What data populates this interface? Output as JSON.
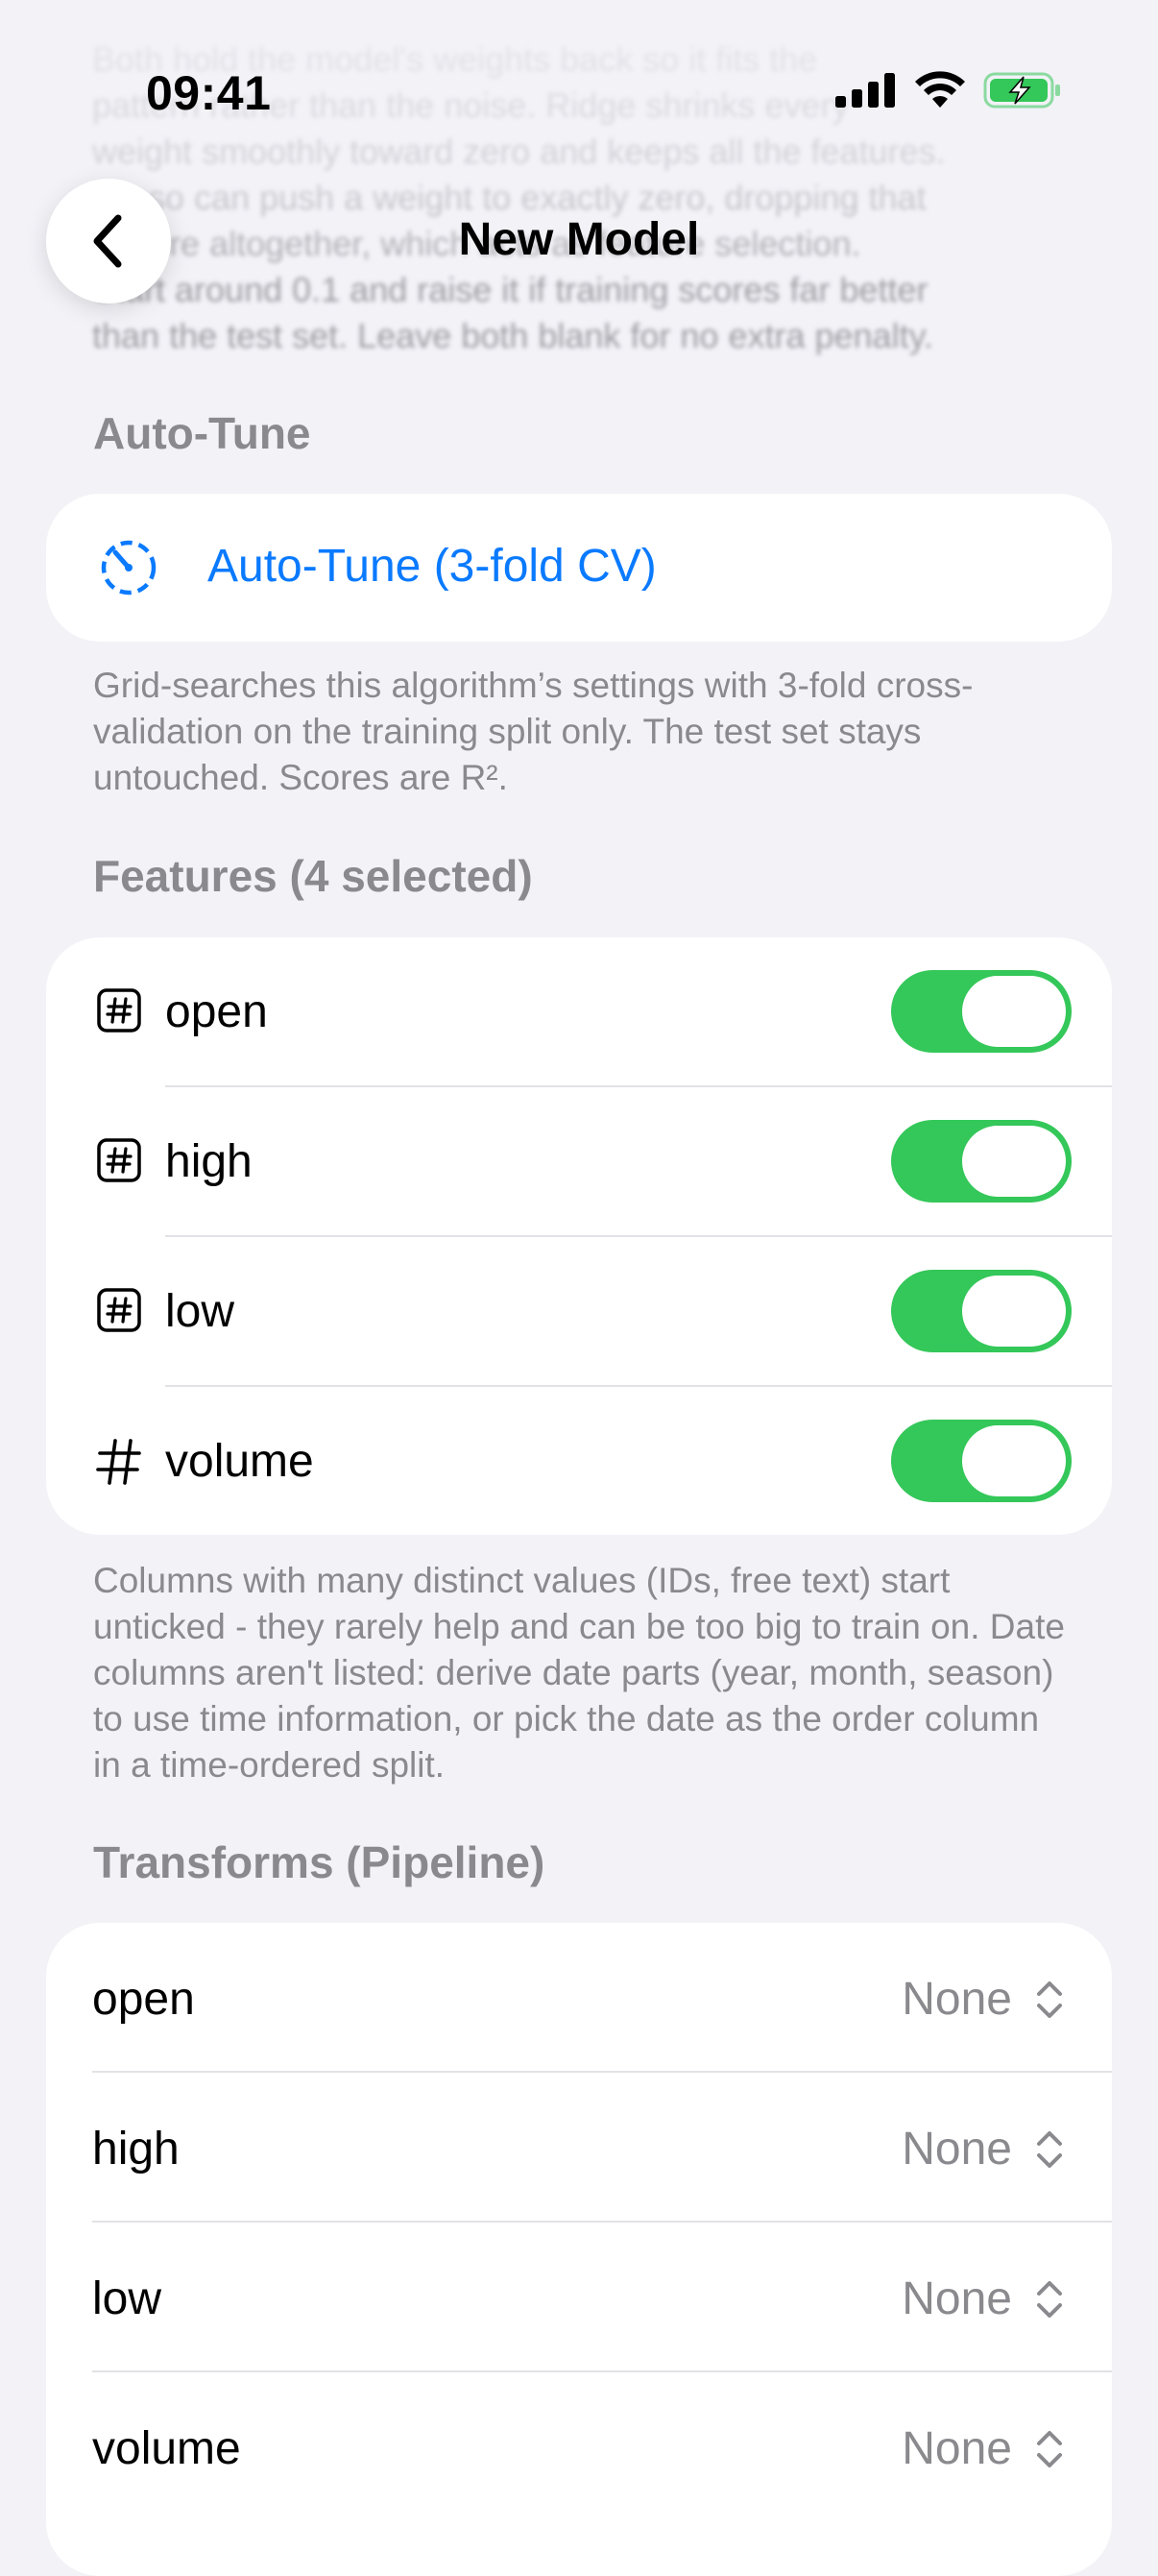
{
  "status_bar": {
    "time": "09:41"
  },
  "nav": {
    "title": "New Model",
    "back_icon": "chevron-left-icon"
  },
  "regularization_note": {
    "lines": [
      "Both hold the model's weights back so it fits the",
      "pattern rather than the noise. Ridge shrinks every",
      "weight smoothly toward zero and keeps all the features.",
      "Lasso can push a weight to exactly zero, dropping that",
      "feature altogether, which acts as feature selection.",
      "Start around 0.1 and raise it if training scores far better",
      "than the test set. Leave both blank for no extra penalty."
    ]
  },
  "autotune": {
    "header": "Auto-Tune",
    "button_label": "Auto-Tune (3-fold CV)",
    "footnote": "Grid-searches this algorithm’s settings with 3-fold cross-validation on the training split only. The test set stays untouched. Scores are R².",
    "accent_color": "#0A7AFF"
  },
  "features": {
    "header": "Features (4 selected)",
    "items": [
      {
        "label": "open",
        "icon": "number-square-icon",
        "enabled": true
      },
      {
        "label": "high",
        "icon": "number-square-icon",
        "enabled": true
      },
      {
        "label": "low",
        "icon": "number-square-icon",
        "enabled": true
      },
      {
        "label": "volume",
        "icon": "number-icon",
        "enabled": true
      }
    ],
    "footnote": "Columns with many distinct values (IDs, free text) start unticked - they rarely help and can be too big to train on. Date columns aren't listed: derive date parts (year, month, season) to use time information, or pick the date as the order column in a time-ordered split.",
    "toggle_color": "#34C759"
  },
  "transforms": {
    "header": "Transforms (Pipeline)",
    "items": [
      {
        "label": "open",
        "value": "None"
      },
      {
        "label": "high",
        "value": "None"
      },
      {
        "label": "low",
        "value": "None"
      },
      {
        "label": "volume",
        "value": "None"
      }
    ]
  }
}
